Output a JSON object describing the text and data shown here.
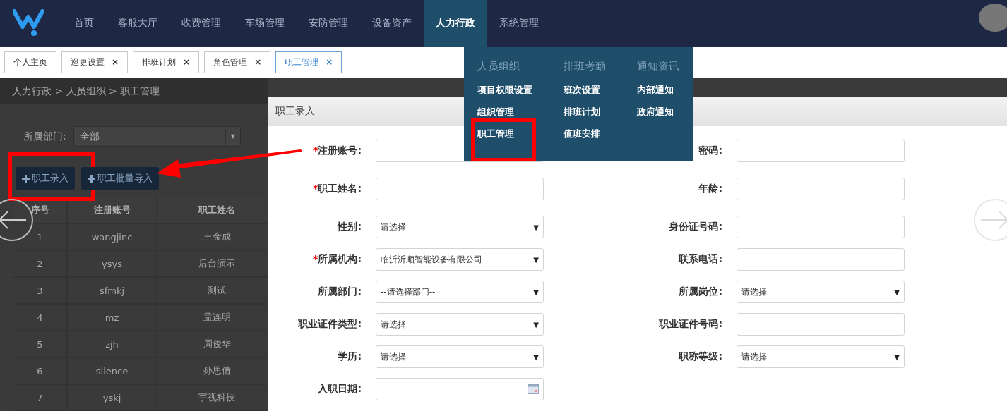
{
  "nav": {
    "items": [
      {
        "label": "首页",
        "selected": false
      },
      {
        "label": "客服大厅",
        "selected": false
      },
      {
        "label": "收费管理",
        "selected": false
      },
      {
        "label": "车场管理",
        "selected": false
      },
      {
        "label": "安防管理",
        "selected": false
      },
      {
        "label": "设备资产",
        "selected": false
      },
      {
        "label": "人力行政",
        "selected": true
      },
      {
        "label": "系统管理",
        "selected": false
      }
    ]
  },
  "tabs": [
    {
      "label": "个人主页",
      "selected": false
    },
    {
      "label": "巡更设置",
      "selected": false,
      "close": "×"
    },
    {
      "label": "排班计划",
      "selected": false,
      "close": "×"
    },
    {
      "label": "角色管理",
      "selected": false,
      "close": "×"
    },
    {
      "label": "职工管理",
      "selected": true,
      "close": "×"
    }
  ],
  "menu": {
    "columns": [
      {
        "heading": "人员组织",
        "items": [
          {
            "label": "项目权限设置",
            "annotated": false
          },
          {
            "label": "组织管理",
            "annotated": false
          },
          {
            "label": "职工管理",
            "annotated": true
          }
        ]
      },
      {
        "heading": "排班考勤",
        "items": [
          {
            "label": "班次设置",
            "annotated": false
          },
          {
            "label": "排班计划",
            "annotated": false
          },
          {
            "label": "值班安排",
            "annotated": false
          }
        ]
      },
      {
        "heading": "通知资讯",
        "items": [
          {
            "label": "内部通知",
            "annotated": false
          },
          {
            "label": "政府通知",
            "annotated": false
          }
        ]
      }
    ]
  },
  "breadcrumb": "人力行政 > 人员组织 > 职工管理",
  "filter": {
    "label": "所属部门:",
    "value": "全部",
    "caret": "▼"
  },
  "buttons": [
    {
      "label": "职工录入",
      "annotated": true
    },
    {
      "label": "职工批量导入",
      "annotated": false
    }
  ],
  "table": {
    "columns": [
      "序号",
      "注册账号",
      "职工姓名"
    ],
    "rows": [
      [
        "1",
        "wangjinc",
        "王金成"
      ],
      [
        "2",
        "ysys",
        "后台演示"
      ],
      [
        "3",
        "sfmkj",
        "测试"
      ],
      [
        "4",
        "mz",
        "孟连明"
      ],
      [
        "5",
        "zjh",
        "周俊华"
      ],
      [
        "6",
        "silence",
        "孙思倩"
      ],
      [
        "7",
        "yskj",
        "宇视科技"
      ]
    ]
  },
  "dialog": {
    "title": "职工录入",
    "rows": [
      [
        {
          "label": "注册账号:",
          "kind": "text",
          "required_mark": "*"
        },
        {
          "label": "密码:",
          "kind": "text"
        }
      ],
      [
        {
          "label": "职工姓名:",
          "kind": "text",
          "required_mark": "*"
        },
        {
          "label": "年龄:",
          "kind": "text"
        }
      ],
      [
        {
          "label": "性别:",
          "kind": "select",
          "value": "请选择",
          "caret": "▼"
        },
        {
          "label": "身份证号码:",
          "kind": "text"
        }
      ],
      [
        {
          "label": "所属机构:",
          "kind": "select",
          "required_mark": "*",
          "value": "临沂沂顺智能设备有限公司",
          "caret": "▼"
        },
        {
          "label": "联系电话:",
          "kind": "text"
        }
      ],
      [
        {
          "label": "所属部门:",
          "kind": "select",
          "value": "--请选择部门--",
          "caret": "▼"
        },
        {
          "label": "所属岗位:",
          "kind": "select",
          "value": "请选择",
          "caret": "▼"
        }
      ],
      [
        {
          "label": "职业证件类型:",
          "kind": "select",
          "value": "请选择",
          "caret": "▼"
        },
        {
          "label": "职业证件号码:",
          "kind": "text"
        }
      ],
      [
        {
          "label": "学历:",
          "kind": "select",
          "value": "请选择",
          "caret": "▼"
        },
        {
          "label": "职称等级:",
          "kind": "select",
          "value": "请选择",
          "caret": "▼"
        }
      ],
      [
        {
          "label": "入职日期:",
          "kind": "date"
        }
      ]
    ]
  }
}
